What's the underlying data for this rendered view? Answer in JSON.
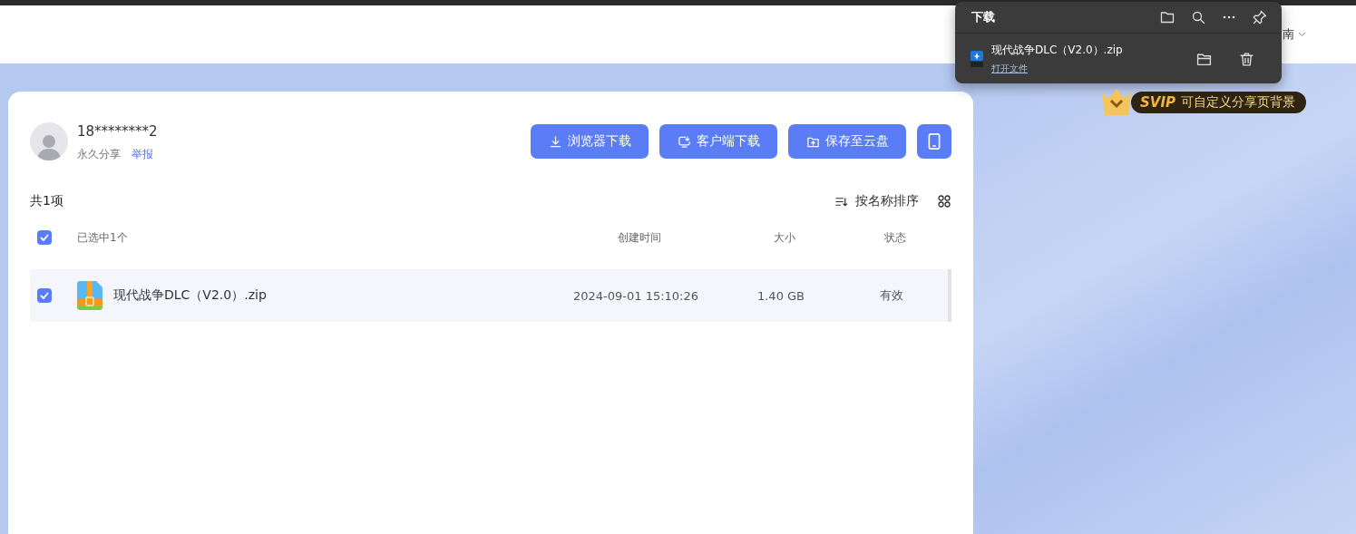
{
  "top_nav": {
    "item_partial": "南"
  },
  "download_panel": {
    "title": "下载",
    "items": [
      {
        "file_name": "现代战争DLC（V2.0）.zip",
        "action": "打开文件"
      }
    ]
  },
  "svip_banner": {
    "badge": "SVIP",
    "text": "可自定义分享页背景"
  },
  "share": {
    "user": "18********2",
    "share_type": "永久分享",
    "report_link": "举报"
  },
  "actions": [
    {
      "kind": "download",
      "label": "浏览器下载"
    },
    {
      "kind": "client",
      "label": "客户端下载"
    },
    {
      "kind": "save",
      "label": "保存至云盘"
    },
    {
      "kind": "mobile"
    }
  ],
  "file_list": {
    "count": "共1项",
    "sort": "按名称排序",
    "header": {
      "checked": true,
      "selection_label": "已选中1个"
    },
    "columns": [
      "创建时间",
      "大小",
      "状态"
    ],
    "rows": [
      {
        "name": "现代战争DLC（V2.0）.zip",
        "created": "2024-09-01 15:10:26",
        "size": "1.40 GB",
        "status": "有效",
        "selected": true
      }
    ]
  }
}
